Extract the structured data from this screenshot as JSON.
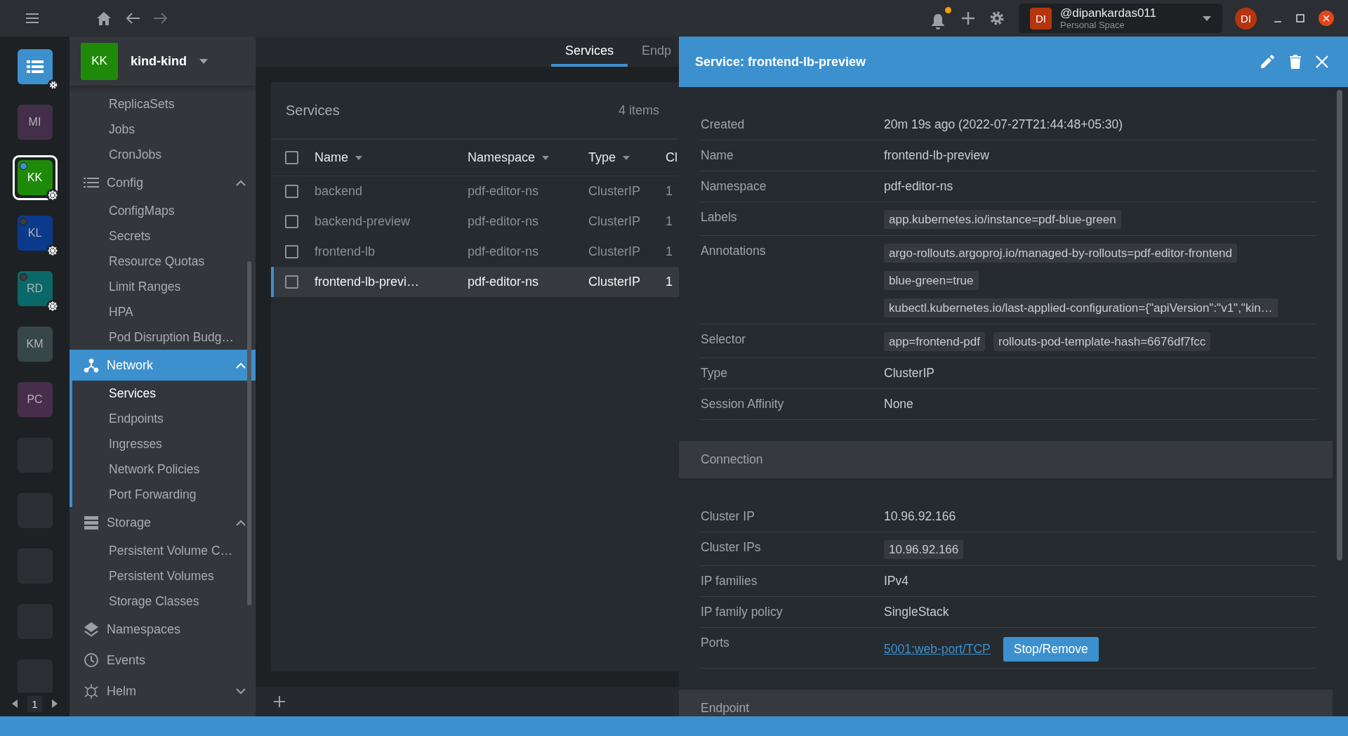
{
  "topbar": {
    "has_notifications": true
  },
  "user": {
    "initials": "DI",
    "name": "@dipankardas011",
    "space": "Personal Space"
  },
  "account_avatar": "DI",
  "rail": [
    {
      "kind": "catalog"
    },
    {
      "kind": "cluster",
      "initials": "MI",
      "color": "#432f4a",
      "selected": false
    },
    {
      "kind": "cluster",
      "initials": "KK",
      "color": "#1f8a0a",
      "selected": true,
      "connected": true,
      "badge": true
    },
    {
      "kind": "cluster",
      "initials": "KL",
      "color": "#0b3a8c",
      "selected": false,
      "connected": false,
      "badge": true
    },
    {
      "kind": "cluster",
      "initials": "RD",
      "color": "#0a6868",
      "selected": false,
      "connected": false,
      "badge": true
    },
    {
      "kind": "cluster",
      "initials": "KM",
      "color": "#374649",
      "selected": false
    },
    {
      "kind": "cluster",
      "initials": "PC",
      "color": "#472e4b",
      "selected": false
    },
    {
      "kind": "empty"
    },
    {
      "kind": "empty"
    },
    {
      "kind": "empty"
    },
    {
      "kind": "empty"
    },
    {
      "kind": "empty"
    }
  ],
  "pager": "1",
  "cluster": {
    "initials": "KK",
    "name": "kind-kind",
    "color": "#1f8a0a"
  },
  "nav": [
    {
      "kind": "link",
      "label": "ReplicaSets",
      "selected": false
    },
    {
      "kind": "link",
      "label": "Jobs",
      "selected": false
    },
    {
      "kind": "link",
      "label": "CronJobs",
      "selected": false
    },
    {
      "kind": "section",
      "label": "Config",
      "expanded": true,
      "selected": false,
      "children": [
        {
          "label": "ConfigMaps",
          "selected": false
        },
        {
          "label": "Secrets",
          "selected": false
        },
        {
          "label": "Resource Quotas",
          "selected": false
        },
        {
          "label": "Limit Ranges",
          "selected": false
        },
        {
          "label": "HPA",
          "selected": false
        },
        {
          "label": "Pod Disruption Budg…",
          "selected": false
        }
      ]
    },
    {
      "kind": "section",
      "label": "Network",
      "expanded": true,
      "selected": true,
      "children": [
        {
          "label": "Services",
          "selected": true
        },
        {
          "label": "Endpoints",
          "selected": false
        },
        {
          "label": "Ingresses",
          "selected": false
        },
        {
          "label": "Network Policies",
          "selected": false
        },
        {
          "label": "Port Forwarding",
          "selected": false
        }
      ]
    },
    {
      "kind": "section",
      "label": "Storage",
      "expanded": true,
      "selected": false,
      "children": [
        {
          "label": "Persistent Volume C…",
          "selected": false
        },
        {
          "label": "Persistent Volumes",
          "selected": false
        },
        {
          "label": "Storage Classes",
          "selected": false
        }
      ]
    },
    {
      "kind": "section",
      "label": "Namespaces",
      "selected": false
    },
    {
      "kind": "section",
      "label": "Events",
      "selected": false
    },
    {
      "kind": "section",
      "label": "Helm",
      "expanded": false,
      "selected": false
    }
  ],
  "tabs": [
    {
      "label": "Services",
      "selected": true
    },
    {
      "label": "Endp",
      "selected": false
    }
  ],
  "table": {
    "title": "Services",
    "count": "4 items",
    "columns": [
      {
        "label": "Name",
        "sortable": true
      },
      {
        "label": "Namespace",
        "sortable": true
      },
      {
        "label": "Type",
        "sortable": true
      },
      {
        "label": "Cl"
      }
    ],
    "all_checked": false,
    "rows": [
      {
        "cells": [
          "backend",
          "pdf-editor-ns",
          "ClusterIP",
          "1"
        ],
        "selected": false,
        "checked": false
      },
      {
        "cells": [
          "backend-preview",
          "pdf-editor-ns",
          "ClusterIP",
          "1"
        ],
        "selected": false,
        "checked": false
      },
      {
        "cells": [
          "frontend-lb",
          "pdf-editor-ns",
          "ClusterIP",
          "1"
        ],
        "selected": false,
        "checked": false
      },
      {
        "cells": [
          "frontend-lb-previ…",
          "pdf-editor-ns",
          "ClusterIP",
          "1"
        ],
        "selected": true,
        "checked": false
      }
    ]
  },
  "detail": {
    "title": "Service: frontend-lb-preview",
    "groups": [
      {
        "rows": [
          {
            "kind": "text",
            "label": "Created",
            "value": "20m 19s ago (2022-07-27T21:44:48+05:30)"
          },
          {
            "kind": "text",
            "label": "Name",
            "value": "frontend-lb-preview"
          },
          {
            "kind": "text",
            "label": "Namespace",
            "value": "pdf-editor-ns"
          },
          {
            "kind": "chips",
            "label": "Labels",
            "chips": [
              "app.kubernetes.io/instance=pdf-blue-green"
            ]
          },
          {
            "kind": "chips",
            "label": "Annotations",
            "chips": [
              "argo-rollouts.argoproj.io/managed-by-rollouts=pdf-editor-frontend",
              "blue-green=true",
              "kubectl.kubernetes.io/last-applied-configuration={\"apiVersion\":\"v1\",\"kin…"
            ]
          },
          {
            "kind": "chips",
            "label": "Selector",
            "chips": [
              "app=frontend-pdf",
              "rollouts-pod-template-hash=6676df7fcc"
            ]
          },
          {
            "kind": "text",
            "label": "Type",
            "value": "ClusterIP"
          },
          {
            "kind": "text",
            "label": "Session Affinity",
            "value": "None"
          }
        ]
      },
      {
        "heading": "Connection",
        "rows": [
          {
            "kind": "text",
            "label": "Cluster IP",
            "value": "10.96.92.166"
          },
          {
            "kind": "chips",
            "label": "Cluster IPs",
            "chips": [
              "10.96.92.166"
            ]
          },
          {
            "kind": "text",
            "label": "IP families",
            "value": "IPv4"
          },
          {
            "kind": "text",
            "label": "IP family policy",
            "value": "SingleStack"
          },
          {
            "kind": "ports",
            "label": "Ports",
            "link": "5001:web-port/TCP",
            "button": "Stop/Remove"
          }
        ]
      },
      {
        "heading": "Endpoint"
      }
    ]
  }
}
